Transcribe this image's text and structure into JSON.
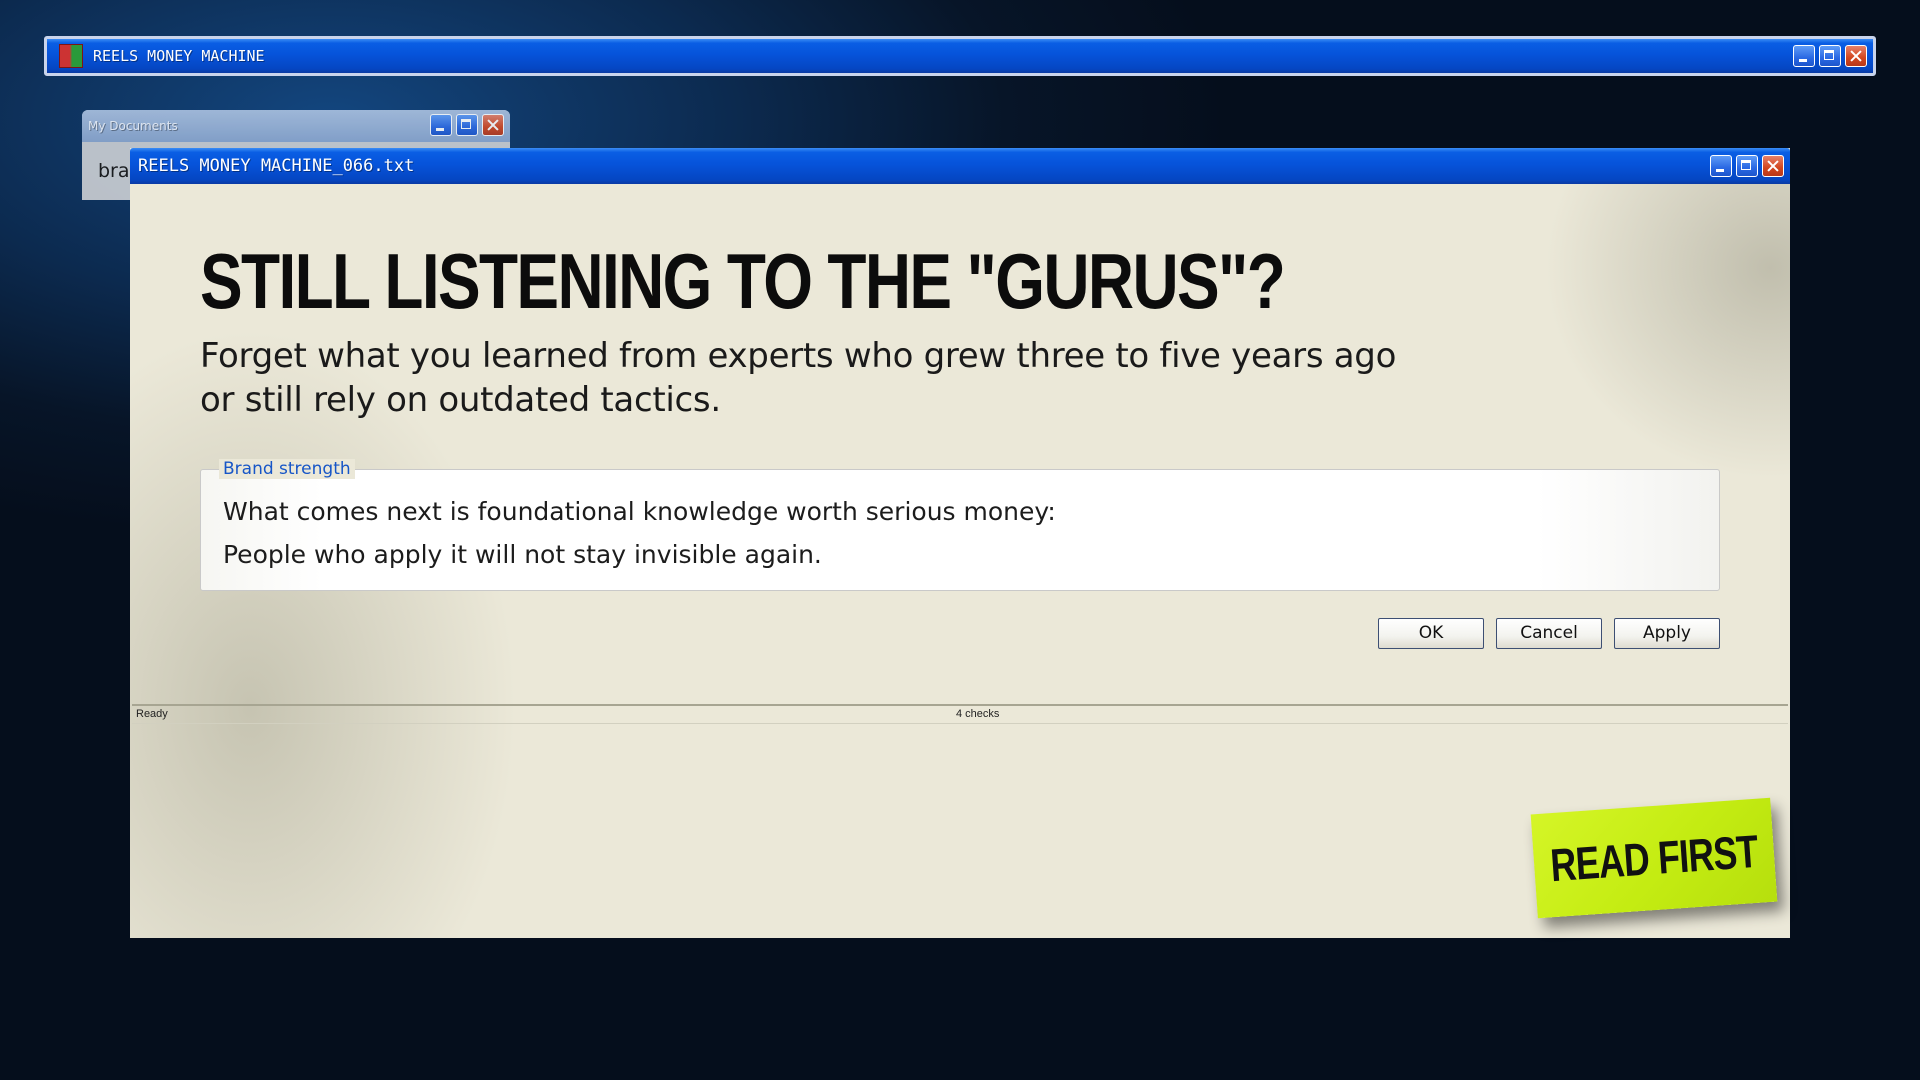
{
  "main_window": {
    "title": "REELS MONEY MACHINE",
    "icon": "app-icon"
  },
  "documents_window": {
    "title": "My Documents",
    "body_text": "bran"
  },
  "doc_window": {
    "title": "REELS MONEY MACHINE_066.txt",
    "headline": "STILL LISTENING TO THE \"GURUS\"?",
    "subline_1": "Forget what you learned from experts who grew three to five years ago",
    "subline_2": "or still rely on outdated tactics.",
    "group": {
      "legend": "Brand strength",
      "line_1": "What comes next is foundational knowledge worth serious money:",
      "line_2": "People who apply it will not stay invisible again."
    },
    "buttons": {
      "ok": "OK",
      "cancel": "Cancel",
      "apply": "Apply"
    },
    "status": {
      "left": "Ready",
      "center": "4 checks"
    }
  },
  "sticky_note": {
    "text": "READ FIRST",
    "color": "#c4ec12"
  },
  "colors": {
    "titlebar_blue": "#0653da",
    "close_red": "#d2461e",
    "window_bg": "#ebe8d8",
    "legend_blue": "#1756c7"
  }
}
